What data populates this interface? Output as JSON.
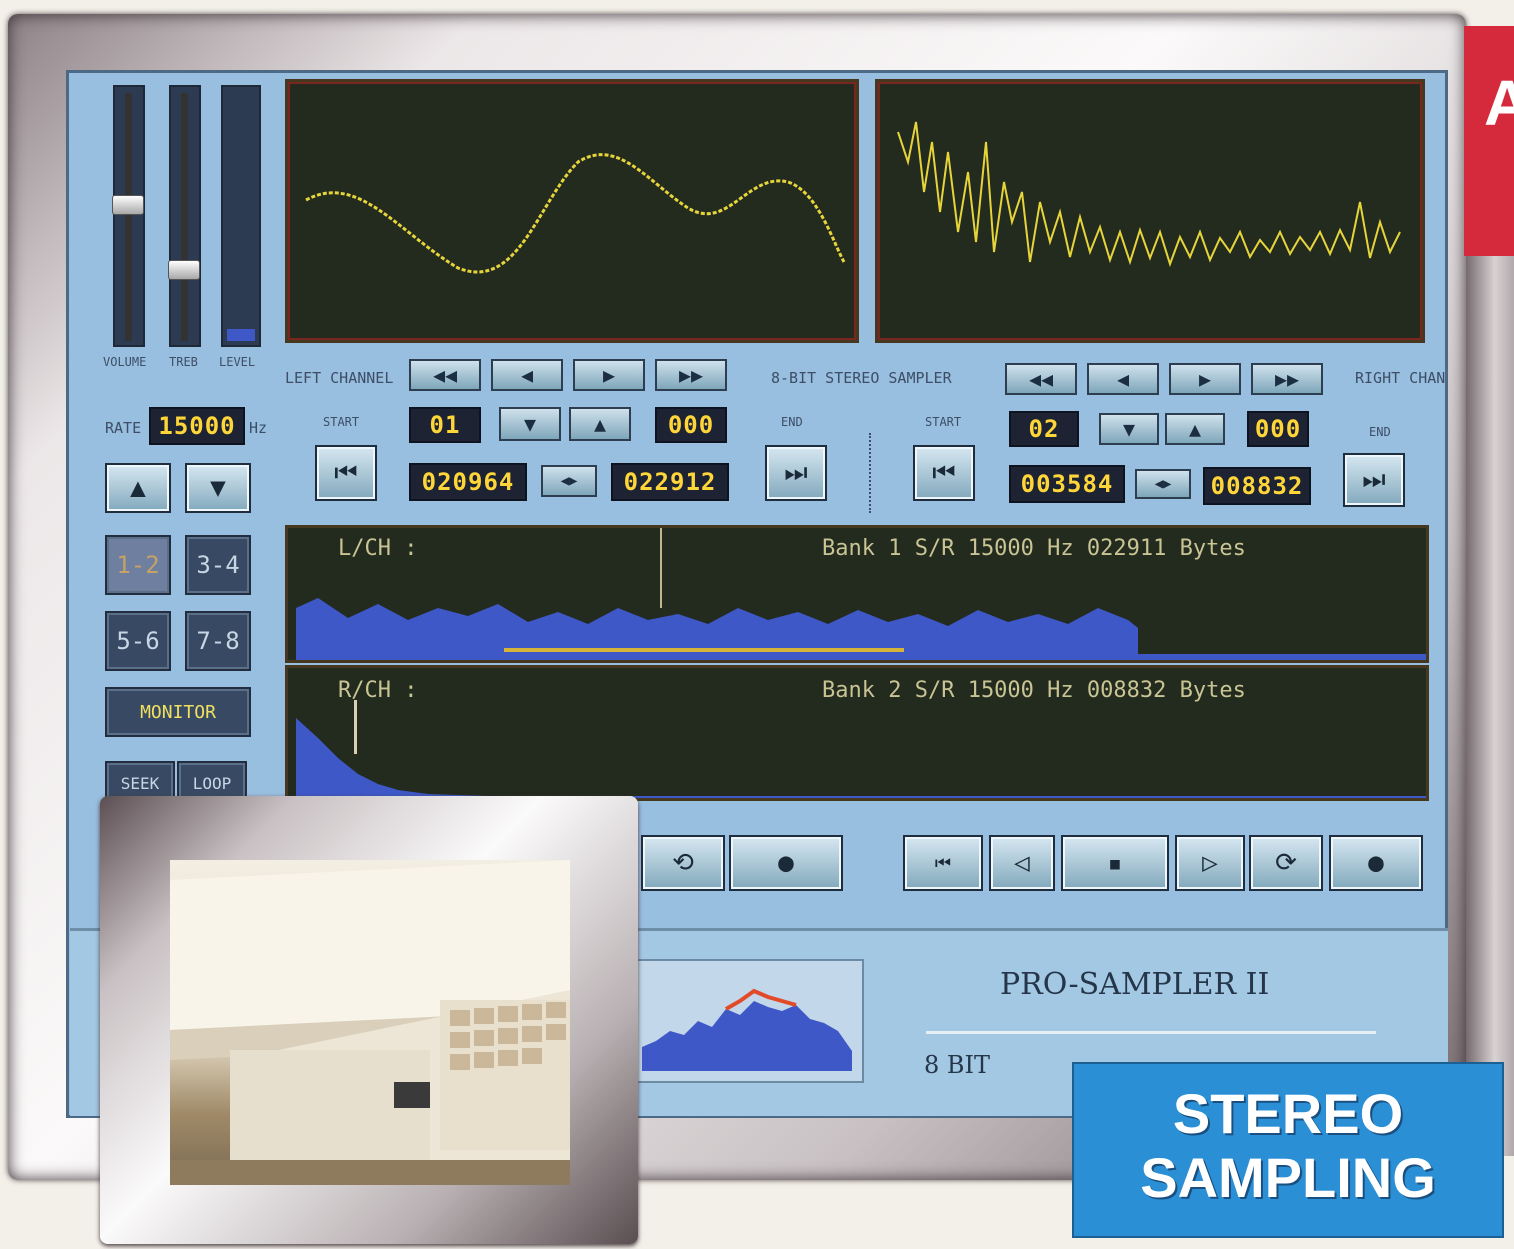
{
  "app": {
    "title": "PRO-SAMPLER II",
    "subtitle": "8 BIT"
  },
  "badge": {
    "line1": "STEREO",
    "line2": "SAMPLING"
  },
  "corner_tab": {
    "letter": "A"
  },
  "sliders": {
    "labels": [
      "VOLUME",
      "TREB",
      "LEVEL"
    ],
    "volume_level": 0.45,
    "treble_level": 0.28,
    "input_level": 0.05
  },
  "rate": {
    "label": "RATE",
    "value": "15000",
    "unit": "Hz"
  },
  "channel_buttons": {
    "row1": [
      "1-2",
      "3-4"
    ],
    "row2": [
      "5-6",
      "7-8"
    ],
    "monitor": "MONITOR",
    "bottom": [
      "SEEK",
      "LOOP"
    ]
  },
  "left_channel": {
    "label": "LEFT CHANNEL",
    "start_label": "START",
    "end_label": "END",
    "bank": "01",
    "offset": "000",
    "start_value": "020964",
    "end_value": "022912"
  },
  "center": {
    "label": "8-BIT STEREO SAMPLER"
  },
  "right_channel": {
    "label": "RIGHT CHANNEL",
    "start_label": "START",
    "end_label": "END",
    "bank": "02",
    "offset": "000",
    "start_value": "003584",
    "end_value": "008832"
  },
  "waveforms": {
    "left_header": "L/CH :",
    "left_info": "Bank 1 S/R 15000 Hz 022911 Bytes",
    "right_header": "R/CH :",
    "right_info": "Bank 2 S/R 15000 Hz 008832 Bytes"
  },
  "colors": {
    "screen": "#98bfe0",
    "scope_trace": "#e6d53a",
    "wave_fill": "#3e58c8",
    "digits": "#ffd63a",
    "badge": "#2a8fd5",
    "corner": "#d52a3b"
  },
  "icons": [
    "rewind-icon",
    "step-back-icon",
    "step-forward-icon",
    "fast-forward-icon",
    "scroll-down-icon",
    "scroll-up-icon",
    "set-start-icon",
    "set-end-icon",
    "link-icon",
    "loop-icon",
    "record-icon",
    "stop-icon",
    "play-icon"
  ]
}
